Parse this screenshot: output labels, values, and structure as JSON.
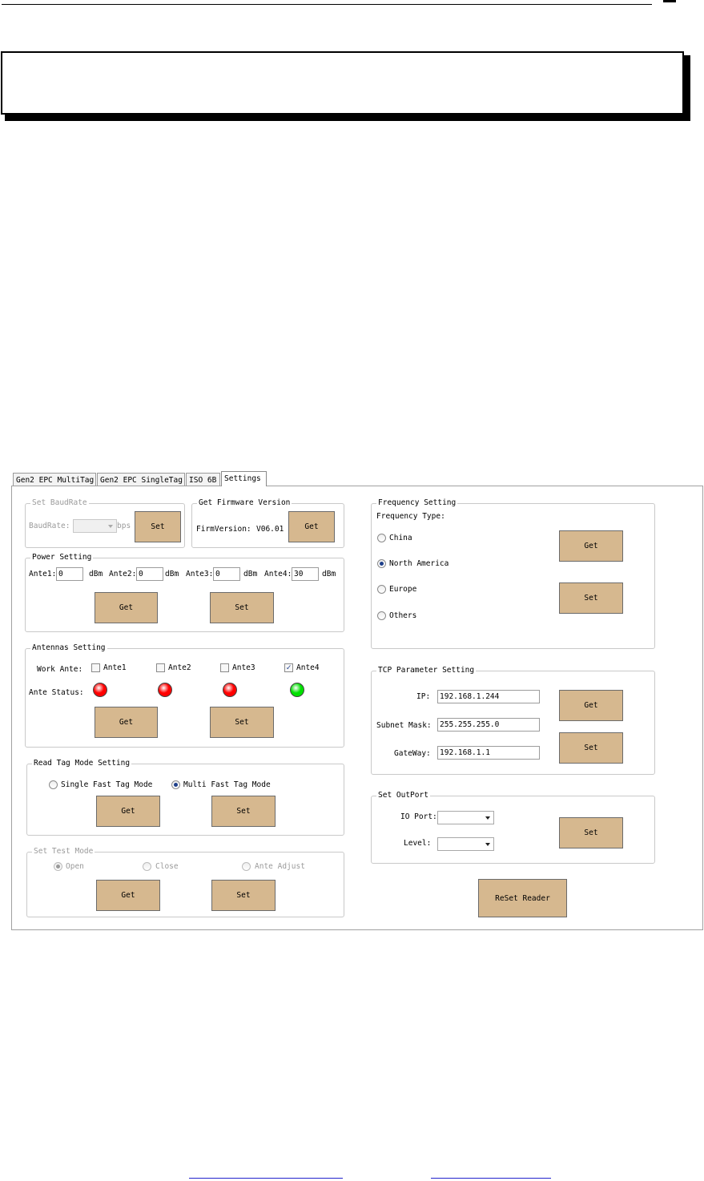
{
  "tabs": [
    "Gen2 EPC MultiTag",
    "Gen2 EPC SingleTag",
    "ISO 6B",
    "Settings"
  ],
  "baudrate": {
    "legend": "Set BaudRate",
    "label": "BaudRate:",
    "unit": "bps",
    "set": "Set"
  },
  "firmware": {
    "legend": "Get Firmware Version",
    "label": "FirmVersion:",
    "value": "V06.01",
    "get": "Get"
  },
  "power": {
    "legend": "Power Setting",
    "antennas": [
      {
        "label": "Ante1:",
        "value": "0",
        "unit": "dBm"
      },
      {
        "label": "Ante2:",
        "value": "0",
        "unit": "dBm"
      },
      {
        "label": "Ante3:",
        "value": "0",
        "unit": "dBm"
      },
      {
        "label": "Ante4:",
        "value": "30",
        "unit": "dBm"
      }
    ],
    "get": "Get",
    "set": "Set"
  },
  "antennas": {
    "legend": "Antennas  Setting",
    "work_label": "Work Ante:",
    "status_label": "Ante Status:",
    "items": [
      {
        "label": "Ante1",
        "checked": false,
        "status_color": "#ff0000"
      },
      {
        "label": "Ante2",
        "checked": false,
        "status_color": "#ff0000"
      },
      {
        "label": "Ante3",
        "checked": false,
        "status_color": "#ff0000"
      },
      {
        "label": "Ante4",
        "checked": true,
        "status_color": "#00e000"
      }
    ],
    "get": "Get",
    "set": "Set"
  },
  "read_mode": {
    "legend": "Read Tag Mode Setting",
    "options": [
      {
        "label": "Single Fast Tag Mode",
        "selected": false
      },
      {
        "label": "Multi Fast Tag Mode",
        "selected": true
      }
    ],
    "get": "Get",
    "set": "Set"
  },
  "test_mode": {
    "legend": "Set Test Mode",
    "options": [
      {
        "label": "Open",
        "selected": true
      },
      {
        "label": "Close",
        "selected": false
      },
      {
        "label": "Ante Adjust",
        "selected": false
      }
    ],
    "get": "Get",
    "set": "Set"
  },
  "frequency": {
    "legend": "Frequency Setting",
    "type_label": "Frequency Type:",
    "options": [
      {
        "label": "China",
        "selected": false
      },
      {
        "label": "North America",
        "selected": true
      },
      {
        "label": "Europe",
        "selected": false
      },
      {
        "label": "Others",
        "selected": false
      }
    ],
    "get": "Get",
    "set": "Set"
  },
  "tcp": {
    "legend": "TCP Parameter Setting",
    "ip_label": "IP:",
    "ip": "192.168.1.244",
    "mask_label": "Subnet Mask:",
    "mask": "255.255.255.0",
    "gateway_label": "GateWay:",
    "gateway": "192.168.1.1",
    "get": "Get",
    "set": "Set"
  },
  "outport": {
    "legend": "Set OutPort",
    "io_label": "IO Port:",
    "level_label": "Level:",
    "set": "Set"
  },
  "reset": "ReSet Reader",
  "colors": {
    "button": "#d6b88f",
    "led_off": "#ff0000",
    "led_on": "#00e000"
  }
}
